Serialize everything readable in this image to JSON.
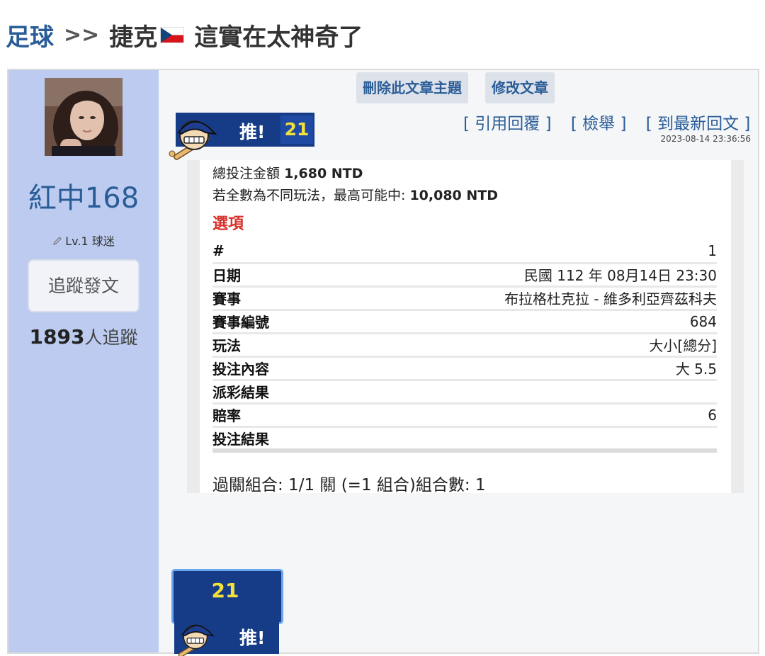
{
  "breadcrumb": {
    "category": "足球",
    "separator": ">>",
    "country": "捷克",
    "title": "這實在太神奇了"
  },
  "author": {
    "name": "紅中168",
    "level": "Lv.1 球迷",
    "follow_label": "追蹤發文",
    "follower_count": "1893",
    "follower_suffix": "人追蹤"
  },
  "admin": {
    "delete_label": "刪除此文章主題",
    "edit_label": "修改文章"
  },
  "push": {
    "label": "推!",
    "count": "21"
  },
  "actions": {
    "quote": "[ 引用回覆 ]",
    "report": "[ 檢舉 ]",
    "latest": "[ 到最新回文 ]"
  },
  "post_time": "2023-08-14 23:36:56",
  "bet": {
    "total_label": "總投注金額",
    "total_value": "1,680 NTD",
    "max_label": "若全數為不同玩法，最高可能中:",
    "max_value": "10,080 NTD",
    "section_title": "選項",
    "rows": [
      {
        "key": "#",
        "value": "1"
      },
      {
        "key": "日期",
        "value": "民國 112 年 08月14日 23:30"
      },
      {
        "key": "賽事",
        "value": "布拉格杜克拉 - 維多利亞齊茲科夫"
      },
      {
        "key": "賽事編號",
        "value": "684"
      },
      {
        "key": "玩法",
        "value": "大小[總分]"
      },
      {
        "key": "投注內容",
        "value": "大 5.5"
      },
      {
        "key": "派彩結果",
        "value": ""
      },
      {
        "key": "賠率",
        "value": "6"
      },
      {
        "key": "投注結果",
        "value": ""
      }
    ],
    "combo": "過關組合: 1/1 關 (=1 組合)組合數: 1"
  },
  "colors": {
    "link_blue": "#2a5d97",
    "sidebar": "#bccbef",
    "badge_blue": "#163c88",
    "badge_yellow": "#f3e03a",
    "section_red": "#d9302a"
  },
  "icons": {
    "flag": "czech-flag-icon",
    "mascot": "baseball-mascot-icon",
    "level": "pencil-icon"
  }
}
